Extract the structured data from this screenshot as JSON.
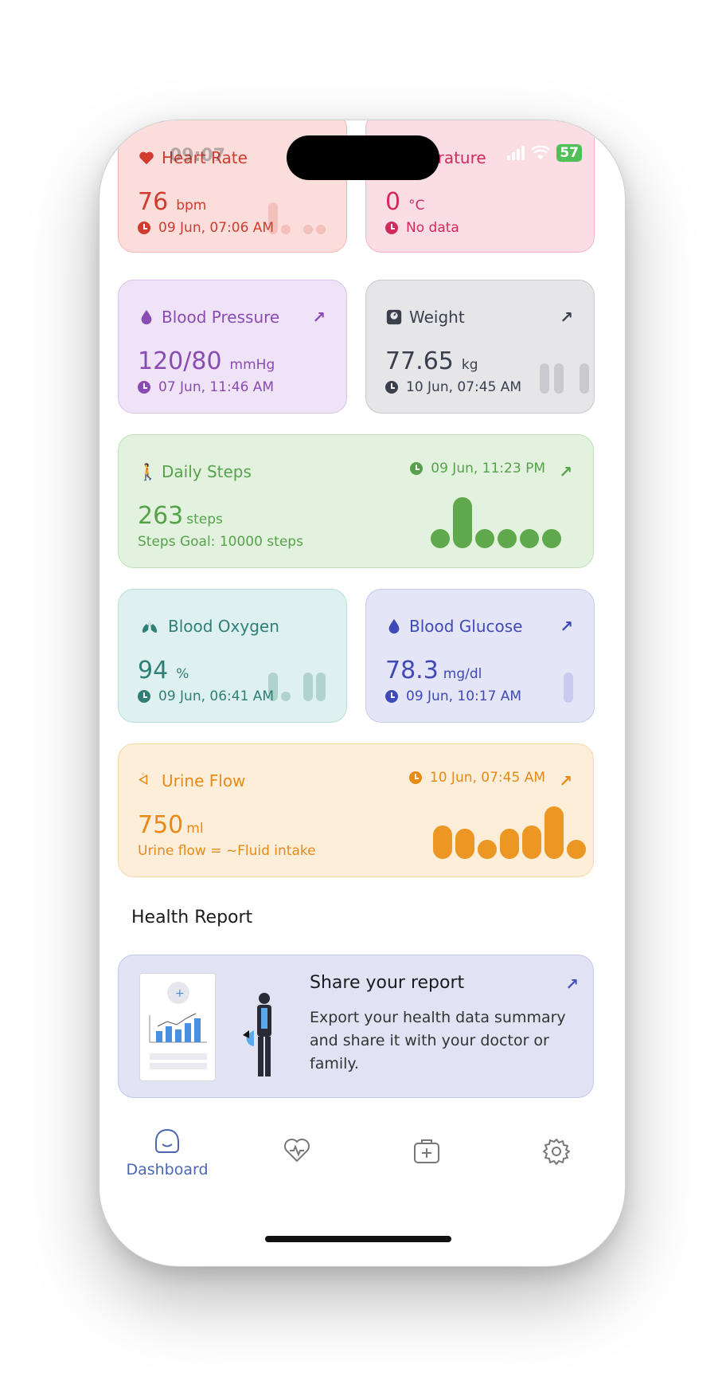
{
  "status": {
    "time": "09:07",
    "battery": "57"
  },
  "cards": {
    "heart": {
      "title": "Heart Rate",
      "value": "76",
      "unit": "bpm",
      "meta": "09 Jun, 07:06 AM",
      "bars": [
        0.55,
        0.18,
        0.18,
        0.18
      ]
    },
    "temp": {
      "title": "Temperature",
      "value": "0",
      "unit": "°C",
      "meta": "No data"
    },
    "bp": {
      "title": "Blood Pressure",
      "value": "120/80",
      "unit": "mmHg",
      "meta": "07 Jun, 11:46 AM"
    },
    "weight": {
      "title": "Weight",
      "value": "77.65",
      "unit": "kg",
      "meta": "10 Jun, 07:45 AM",
      "bars": [
        1,
        1,
        1
      ]
    },
    "steps": {
      "title": "Daily Steps",
      "value": "263",
      "unit": "steps",
      "meta": "09 Jun, 11:23 PM",
      "goal": "Steps Goal: 10000 steps",
      "bars": [
        0.4,
        1,
        0.4,
        0.4,
        0.4,
        0.4
      ]
    },
    "oxy": {
      "title": "Blood Oxygen",
      "value": "94",
      "unit": "%",
      "meta": "09 Jun, 06:41 AM",
      "bars": [
        1,
        0.3,
        0.3,
        1,
        1
      ]
    },
    "glu": {
      "title": "Blood Glucose",
      "value": "78.3",
      "unit": "mg/dl",
      "meta": "09 Jun, 10:17 AM",
      "bars": [
        1
      ]
    },
    "urine": {
      "title": "Urine Flow",
      "value": "750",
      "unit": "ml",
      "meta": "10 Jun, 07:45 AM",
      "goal": "Urine flow = ~Fluid intake",
      "bars": [
        0.62,
        0.55,
        0.35,
        0.55,
        0.62,
        1,
        0.35
      ]
    }
  },
  "report": {
    "section_title": "Health Report",
    "title": "Share your report",
    "text": "Export your health data summary and share it with your doctor or family."
  },
  "tabs": [
    {
      "label": "Dashboard",
      "icon": "home-icon"
    },
    {
      "label": "",
      "icon": "heart-pulse-icon"
    },
    {
      "label": "",
      "icon": "medical-kit-icon"
    },
    {
      "label": "",
      "icon": "gear-icon"
    }
  ],
  "colors": {
    "heart": "#d23b2f",
    "temp": "#d12b5c",
    "bp": "#8a4bb3",
    "weight": "#3a3f4e",
    "steps": "#56a24a",
    "oxy": "#2f7f77",
    "glu": "#3f49b7",
    "urine": "#e88a18",
    "tab_active": "#4a67b2"
  }
}
